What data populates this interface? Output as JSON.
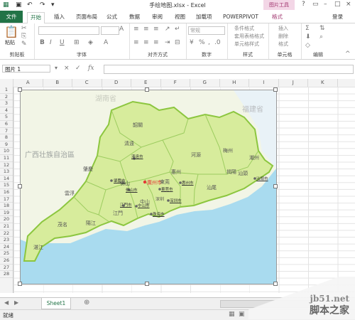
{
  "window": {
    "title": "手绘地图.xlsx - Excel",
    "picture_tools": "图片工具",
    "sign_in": "登录"
  },
  "tabs": [
    "文件",
    "开始",
    "插入",
    "页面布局",
    "公式",
    "数据",
    "审阅",
    "视图",
    "加载项",
    "POWERPIVOT",
    "格式"
  ],
  "ribbon": {
    "groups": [
      "剪贴板",
      "字体",
      "对齐方式",
      "数字",
      "样式",
      "单元格",
      "编辑"
    ],
    "paste": "粘贴",
    "number_format": "常规",
    "styles": [
      "条件格式",
      "套用表格格式",
      "单元格样式"
    ],
    "cells": [
      "插入",
      "删除",
      "格式"
    ],
    "currency": "%"
  },
  "formula_bar": {
    "name_box": "图片 1",
    "fx": "fx"
  },
  "columns": [
    "A",
    "B",
    "C",
    "D",
    "E",
    "F",
    "G",
    "H",
    "I",
    "J",
    "K"
  ],
  "rows": [
    "1",
    "2",
    "3",
    "4",
    "5",
    "6",
    "7",
    "8",
    "9",
    "10",
    "11",
    "12",
    "13",
    "14",
    "15",
    "16",
    "17",
    "18",
    "19",
    "20",
    "21",
    "22",
    "23",
    "24",
    "25",
    "26",
    "27",
    "28"
  ],
  "map": {
    "regions": [
      "湖南省",
      "福建省",
      "广西壮族自治區",
      "韶關",
      "清遠",
      "河源",
      "梅州",
      "潮州",
      "肇慶",
      "廣州市",
      "惠州",
      "揭陽",
      "汕頭",
      "雲浮",
      "佛山",
      "東莞",
      "汕尾",
      "茂名",
      "陽江",
      "江門",
      "中山",
      "湛江",
      "深圳"
    ],
    "cities": [
      "清遠市",
      "肇慶市",
      "廣州市",
      "佛山市",
      "東莞市",
      "惠州市",
      "汕頭市",
      "江門市",
      "中山市",
      "珠海市",
      "深圳市"
    ],
    "colors": {
      "land": "#d7ec9c",
      "border": "#8cc63f",
      "sea": "#a9dbef",
      "neighbor": "#f2f5e6",
      "capital": "#e53935"
    }
  },
  "sheet_tabs": [
    "Sheet1"
  ],
  "status": {
    "ready": "就绪"
  },
  "watermark": {
    "site": "jb51.net",
    "name": "脚本之家"
  },
  "colors": {
    "accent": "#217346",
    "picture_tools": "#a0346e"
  }
}
